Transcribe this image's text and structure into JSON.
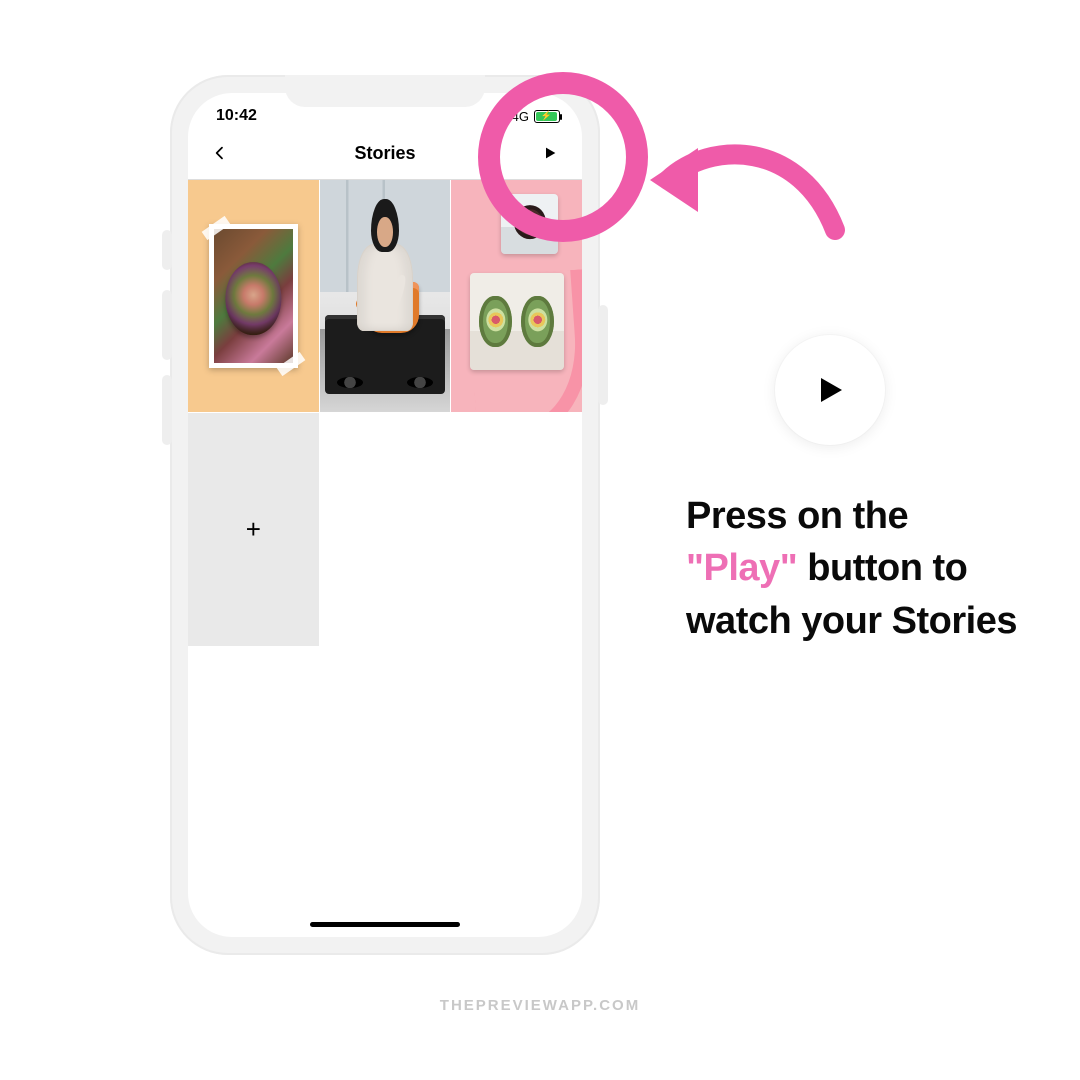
{
  "statusbar": {
    "time": "10:42",
    "network": "4G"
  },
  "navbar": {
    "title": "Stories"
  },
  "grid": {
    "add_label": "+"
  },
  "instructions": {
    "line1": "Press on the",
    "accent": "\"Play\"",
    "line2_rest": " button to watch your Stories"
  },
  "watermark": "THEPREVIEWAPP.COM",
  "colors": {
    "accent_pink": "#ef5ba9",
    "text_pink": "#ee6fb5"
  }
}
